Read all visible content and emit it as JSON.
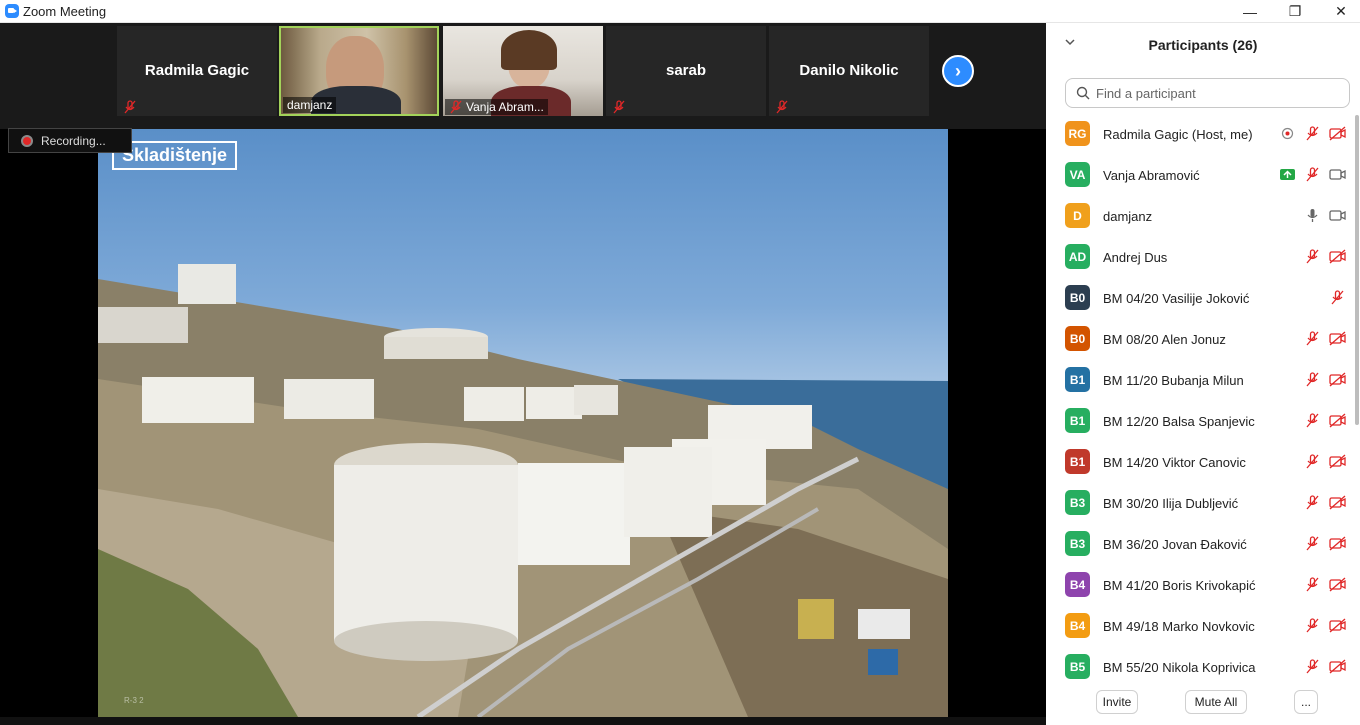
{
  "window": {
    "title": "Zoom Meeting",
    "minimize": "—",
    "restore": "❐",
    "close": "✕"
  },
  "gallery": {
    "tiles": [
      {
        "name": "Radmila Gagic",
        "label": ""
      },
      {
        "name": "",
        "label": "damjanz"
      },
      {
        "name": "",
        "label": "Vanja Abram..."
      },
      {
        "name": "sarab",
        "label": ""
      },
      {
        "name": "Danilo Nikolic",
        "label": ""
      }
    ],
    "next": "›"
  },
  "recording": {
    "label": "Recording..."
  },
  "share": {
    "title": "Skladištenje",
    "watermark": "R-3 2"
  },
  "panel": {
    "title": "Participants (26)",
    "search_placeholder": "Find a participant",
    "participants": [
      {
        "initials": "RG",
        "name": "Radmila Gagic (Host, me)",
        "color": "#f0931c",
        "icons": [
          "record-icon",
          "mic-muted-icon",
          "video-off-icon"
        ]
      },
      {
        "initials": "VA",
        "name": "Vanja Abramović",
        "color": "#27ae60",
        "icons": [
          "share-icon",
          "mic-muted-icon",
          "video-on-icon"
        ]
      },
      {
        "initials": "D",
        "name": "damjanz",
        "color": "#f0a01c",
        "icons": [
          "mic-on-icon",
          "video-on-icon"
        ]
      },
      {
        "initials": "AD",
        "name": "Andrej Dus",
        "color": "#27ae60",
        "icons": [
          "mic-muted-icon",
          "video-off-icon"
        ]
      },
      {
        "initials": "B0",
        "name": "BM 04/20 Vasilije Joković",
        "color": "#2c3e50",
        "icons": [
          "mic-muted-icon"
        ]
      },
      {
        "initials": "B0",
        "name": "BM 08/20 Alen Jonuz",
        "color": "#d35400",
        "icons": [
          "mic-muted-icon",
          "video-off-icon"
        ]
      },
      {
        "initials": "B1",
        "name": "BM 11/20 Bubanja Milun",
        "color": "#2471a3",
        "icons": [
          "mic-muted-icon",
          "video-off-icon"
        ]
      },
      {
        "initials": "B1",
        "name": "BM 12/20 Balsa Spanjevic",
        "color": "#27ae60",
        "icons": [
          "mic-muted-icon",
          "video-off-icon"
        ]
      },
      {
        "initials": "B1",
        "name": "BM 14/20 Viktor Canovic",
        "color": "#c0392b",
        "icons": [
          "mic-muted-icon",
          "video-off-icon"
        ]
      },
      {
        "initials": "B3",
        "name": "BM 30/20 Ilija Dubljević",
        "color": "#27ae60",
        "icons": [
          "mic-muted-icon",
          "video-off-icon"
        ]
      },
      {
        "initials": "B3",
        "name": "BM 36/20 Jovan Đaković",
        "color": "#27ae60",
        "icons": [
          "mic-muted-icon",
          "video-off-icon"
        ]
      },
      {
        "initials": "B4",
        "name": "BM 41/20 Boris Krivokapić",
        "color": "#8e44ad",
        "icons": [
          "mic-muted-icon",
          "video-off-icon"
        ]
      },
      {
        "initials": "B4",
        "name": "BM 49/18 Marko Novkovic",
        "color": "#f39c12",
        "icons": [
          "mic-muted-icon",
          "video-off-icon"
        ]
      },
      {
        "initials": "B5",
        "name": "BM 55/20 Nikola Koprivica",
        "color": "#27ae60",
        "icons": [
          "mic-muted-icon",
          "video-off-icon"
        ]
      }
    ],
    "footer": {
      "invite": "Invite",
      "mute_all": "Mute All",
      "more": "..."
    }
  }
}
